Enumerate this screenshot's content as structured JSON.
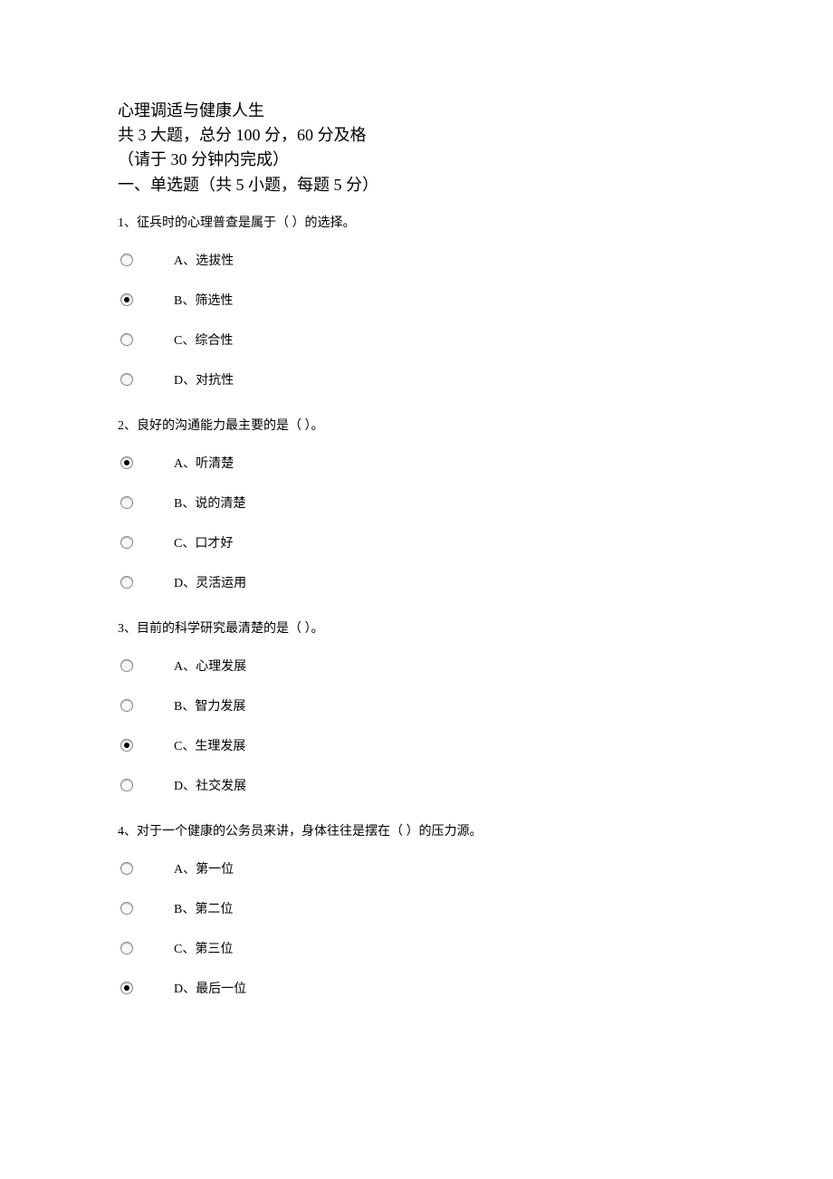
{
  "header": {
    "title": "心理调适与健康人生",
    "summary": "共 3 大题，总分 100 分，60 分及格",
    "time_note": "（请于 30 分钟内完成）",
    "section1": "一、单选题（共 5 小题，每题 5 分）"
  },
  "questions": [
    {
      "text": "1、征兵时的心理普查是属于（  ）的选择。",
      "selected": 1,
      "options": [
        "A、选拔性",
        "B、筛选性",
        "C、综合性",
        "D、对抗性"
      ]
    },
    {
      "text": "2、良好的沟通能力最主要的是（  ）。",
      "selected": 0,
      "options": [
        "A、听清楚",
        "B、说的清楚",
        "C、口才好",
        "D、灵活运用"
      ]
    },
    {
      "text": "3、目前的科学研究最清楚的是（  ）。",
      "selected": 2,
      "options": [
        "A、心理发展",
        "B、智力发展",
        "C、生理发展",
        "D、社交发展"
      ]
    },
    {
      "text": "4、对于一个健康的公务员来讲，身体往往是摆在（  ）的压力源。",
      "selected": 3,
      "options": [
        "A、第一位",
        "B、第二位",
        "C、第三位",
        "D、最后一位"
      ]
    }
  ]
}
